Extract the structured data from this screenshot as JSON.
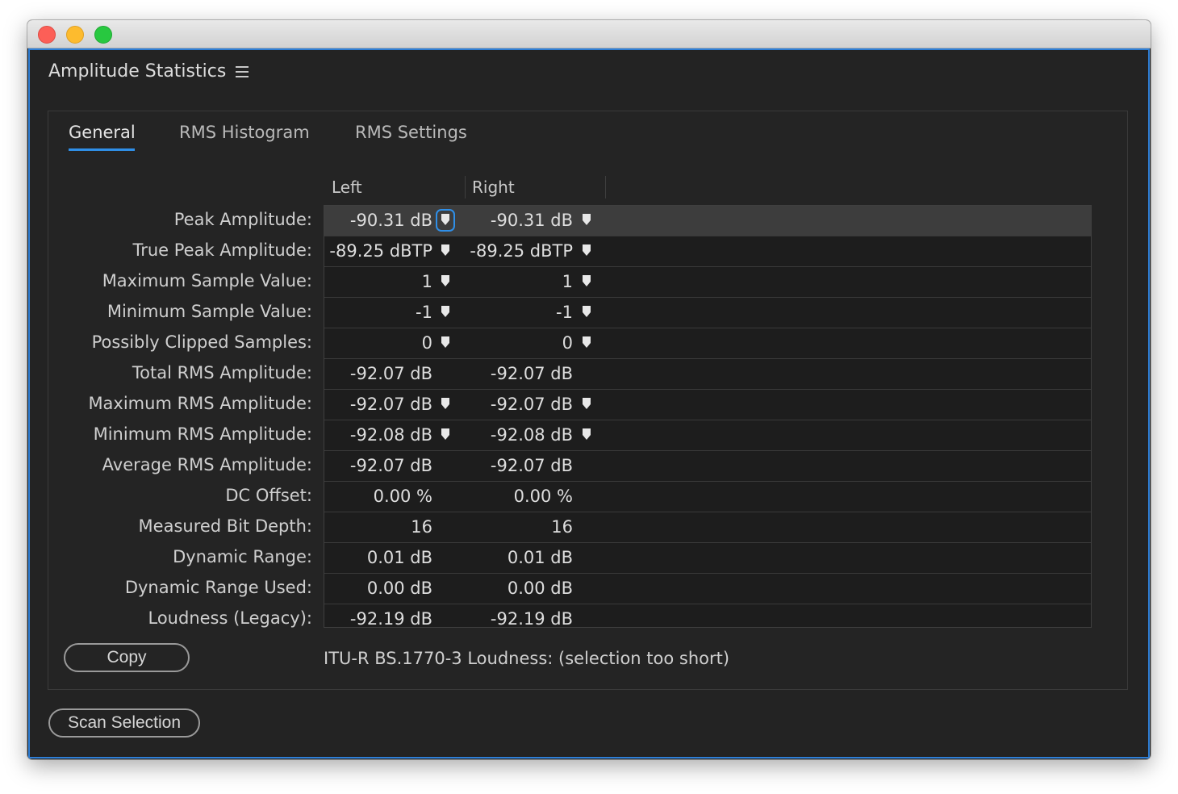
{
  "window": {
    "title": "Amplitude Statistics"
  },
  "tabs": [
    {
      "label": "General",
      "active": true
    },
    {
      "label": "RMS Histogram",
      "active": false
    },
    {
      "label": "RMS Settings",
      "active": false
    }
  ],
  "columns": {
    "left": "Left",
    "right": "Right"
  },
  "rows": [
    {
      "label": "Peak Amplitude:",
      "left": "-90.31 dB",
      "right": "-90.31 dB",
      "pin": true,
      "selected": true
    },
    {
      "label": "True Peak Amplitude:",
      "left": "-89.25 dBTP",
      "right": "-89.25 dBTP",
      "pin": true,
      "selected": false
    },
    {
      "label": "Maximum Sample Value:",
      "left": "1",
      "right": "1",
      "pin": true,
      "selected": false
    },
    {
      "label": "Minimum Sample Value:",
      "left": "-1",
      "right": "-1",
      "pin": true,
      "selected": false
    },
    {
      "label": "Possibly Clipped Samples:",
      "left": "0",
      "right": "0",
      "pin": true,
      "selected": false
    },
    {
      "label": "Total RMS Amplitude:",
      "left": "-92.07 dB",
      "right": "-92.07 dB",
      "pin": false,
      "selected": false
    },
    {
      "label": "Maximum RMS Amplitude:",
      "left": "-92.07 dB",
      "right": "-92.07 dB",
      "pin": true,
      "selected": false
    },
    {
      "label": "Minimum RMS Amplitude:",
      "left": "-92.08 dB",
      "right": "-92.08 dB",
      "pin": true,
      "selected": false
    },
    {
      "label": "Average RMS Amplitude:",
      "left": "-92.07 dB",
      "right": "-92.07 dB",
      "pin": false,
      "selected": false
    },
    {
      "label": "DC Offset:",
      "left": "0.00 %",
      "right": "0.00 %",
      "pin": false,
      "selected": false
    },
    {
      "label": "Measured Bit Depth:",
      "left": "16",
      "right": "16",
      "pin": false,
      "selected": false
    },
    {
      "label": "Dynamic Range:",
      "left": "0.01 dB",
      "right": "0.01 dB",
      "pin": false,
      "selected": false
    },
    {
      "label": "Dynamic Range Used:",
      "left": "0.00 dB",
      "right": "0.00 dB",
      "pin": false,
      "selected": false
    },
    {
      "label": "Loudness (Legacy):",
      "left": "-92.19 dB",
      "right": "-92.19 dB",
      "pin": false,
      "selected": false
    }
  ],
  "copy_button": "Copy",
  "itu_text": "ITU-R BS.1770-3 Loudness: (selection too short)",
  "scan_button": "Scan Selection",
  "colors": {
    "accent": "#2f8fe8",
    "panel_bg": "#232323"
  },
  "icons": {
    "menu": "hamburger-menu-icon",
    "pin": "marker-pin-icon"
  }
}
